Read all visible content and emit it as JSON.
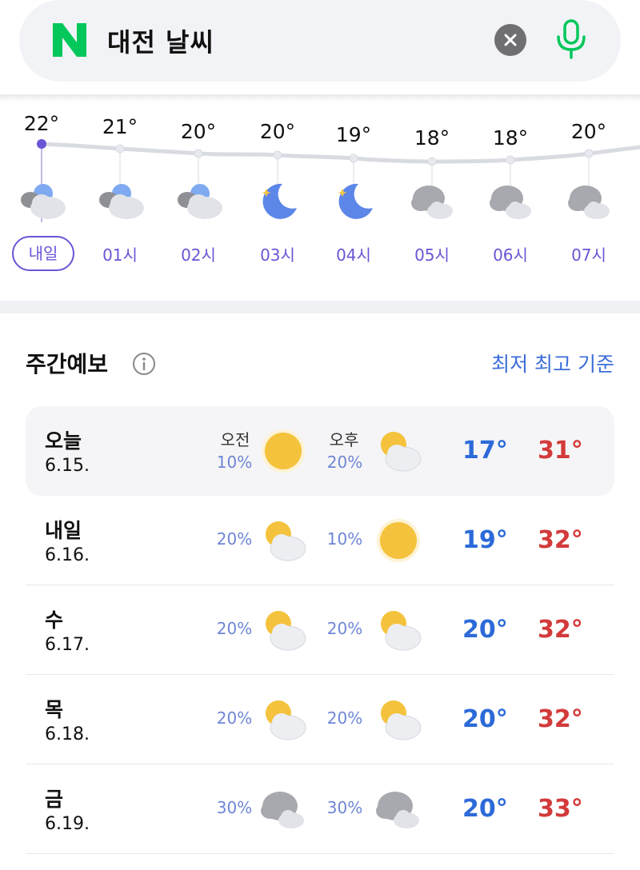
{
  "search": {
    "query": "대전 날씨"
  },
  "hourly": [
    {
      "temp": "22°",
      "label": "내일",
      "icon": "cloudy-night-icon"
    },
    {
      "temp": "21°",
      "label": "01시",
      "icon": "cloudy-night-icon"
    },
    {
      "temp": "20°",
      "label": "02시",
      "icon": "cloudy-night-icon"
    },
    {
      "temp": "20°",
      "label": "03시",
      "icon": "moon-icon"
    },
    {
      "temp": "19°",
      "label": "04시",
      "icon": "moon-icon"
    },
    {
      "temp": "18°",
      "label": "05시",
      "icon": "overcast-icon"
    },
    {
      "temp": "18°",
      "label": "06시",
      "icon": "overcast-icon"
    },
    {
      "temp": "20°",
      "label": "07시",
      "icon": "overcast-icon"
    }
  ],
  "weekly": {
    "title": "주간예보",
    "basis": "최저 최고 기준",
    "am_label": "오전",
    "pm_label": "오후",
    "days": [
      {
        "name": "오늘",
        "date": "6.15.",
        "am_rain": "10%",
        "pm_rain": "20%",
        "am_icon": "sunny-icon",
        "pm_icon": "partly-cloudy-icon",
        "low": "17°",
        "high": "31°"
      },
      {
        "name": "내일",
        "date": "6.16.",
        "am_rain": "20%",
        "pm_rain": "10%",
        "am_icon": "partly-cloudy-icon",
        "pm_icon": "sunny-icon",
        "low": "19°",
        "high": "32°"
      },
      {
        "name": "수",
        "date": "6.17.",
        "am_rain": "20%",
        "pm_rain": "20%",
        "am_icon": "partly-cloudy-icon",
        "pm_icon": "partly-cloudy-icon",
        "low": "20°",
        "high": "32°"
      },
      {
        "name": "목",
        "date": "6.18.",
        "am_rain": "20%",
        "pm_rain": "20%",
        "am_icon": "partly-cloudy-icon",
        "pm_icon": "partly-cloudy-icon",
        "low": "20°",
        "high": "32°"
      },
      {
        "name": "금",
        "date": "6.19.",
        "am_rain": "30%",
        "pm_rain": "30%",
        "am_icon": "overcast-icon",
        "pm_icon": "overcast-icon",
        "low": "20°",
        "high": "33°"
      }
    ]
  },
  "colors": {
    "accent_purple": "#6a55d6",
    "low_blue": "#2c6ad9",
    "high_red": "#d33a3a",
    "naver_green": "#03c75a"
  }
}
